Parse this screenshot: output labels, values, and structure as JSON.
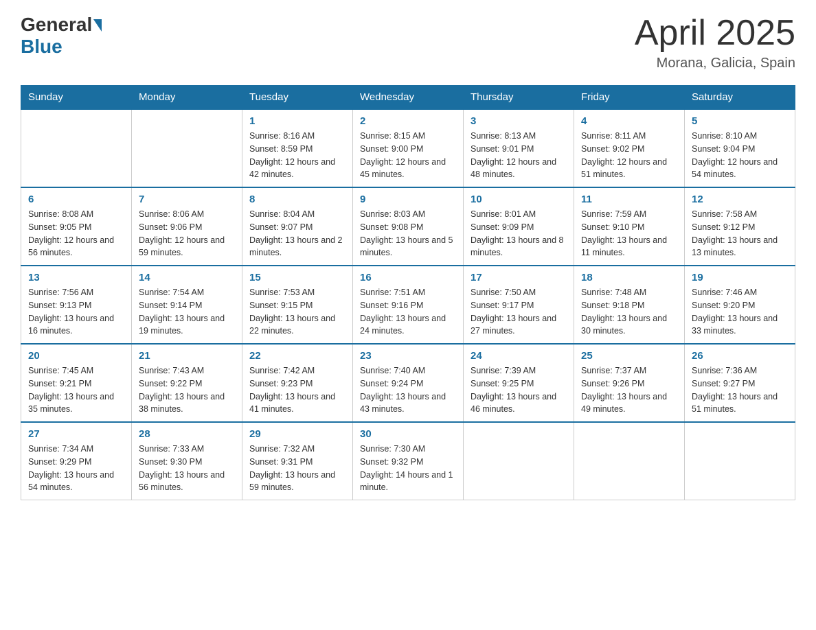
{
  "header": {
    "logo_general": "General",
    "logo_blue": "Blue",
    "month_title": "April 2025",
    "location": "Morana, Galicia, Spain"
  },
  "days_of_week": [
    "Sunday",
    "Monday",
    "Tuesday",
    "Wednesday",
    "Thursday",
    "Friday",
    "Saturday"
  ],
  "weeks": [
    [
      {
        "day": "",
        "sunrise": "",
        "sunset": "",
        "daylight": ""
      },
      {
        "day": "",
        "sunrise": "",
        "sunset": "",
        "daylight": ""
      },
      {
        "day": "1",
        "sunrise": "Sunrise: 8:16 AM",
        "sunset": "Sunset: 8:59 PM",
        "daylight": "Daylight: 12 hours and 42 minutes."
      },
      {
        "day": "2",
        "sunrise": "Sunrise: 8:15 AM",
        "sunset": "Sunset: 9:00 PM",
        "daylight": "Daylight: 12 hours and 45 minutes."
      },
      {
        "day": "3",
        "sunrise": "Sunrise: 8:13 AM",
        "sunset": "Sunset: 9:01 PM",
        "daylight": "Daylight: 12 hours and 48 minutes."
      },
      {
        "day": "4",
        "sunrise": "Sunrise: 8:11 AM",
        "sunset": "Sunset: 9:02 PM",
        "daylight": "Daylight: 12 hours and 51 minutes."
      },
      {
        "day": "5",
        "sunrise": "Sunrise: 8:10 AM",
        "sunset": "Sunset: 9:04 PM",
        "daylight": "Daylight: 12 hours and 54 minutes."
      }
    ],
    [
      {
        "day": "6",
        "sunrise": "Sunrise: 8:08 AM",
        "sunset": "Sunset: 9:05 PM",
        "daylight": "Daylight: 12 hours and 56 minutes."
      },
      {
        "day": "7",
        "sunrise": "Sunrise: 8:06 AM",
        "sunset": "Sunset: 9:06 PM",
        "daylight": "Daylight: 12 hours and 59 minutes."
      },
      {
        "day": "8",
        "sunrise": "Sunrise: 8:04 AM",
        "sunset": "Sunset: 9:07 PM",
        "daylight": "Daylight: 13 hours and 2 minutes."
      },
      {
        "day": "9",
        "sunrise": "Sunrise: 8:03 AM",
        "sunset": "Sunset: 9:08 PM",
        "daylight": "Daylight: 13 hours and 5 minutes."
      },
      {
        "day": "10",
        "sunrise": "Sunrise: 8:01 AM",
        "sunset": "Sunset: 9:09 PM",
        "daylight": "Daylight: 13 hours and 8 minutes."
      },
      {
        "day": "11",
        "sunrise": "Sunrise: 7:59 AM",
        "sunset": "Sunset: 9:10 PM",
        "daylight": "Daylight: 13 hours and 11 minutes."
      },
      {
        "day": "12",
        "sunrise": "Sunrise: 7:58 AM",
        "sunset": "Sunset: 9:12 PM",
        "daylight": "Daylight: 13 hours and 13 minutes."
      }
    ],
    [
      {
        "day": "13",
        "sunrise": "Sunrise: 7:56 AM",
        "sunset": "Sunset: 9:13 PM",
        "daylight": "Daylight: 13 hours and 16 minutes."
      },
      {
        "day": "14",
        "sunrise": "Sunrise: 7:54 AM",
        "sunset": "Sunset: 9:14 PM",
        "daylight": "Daylight: 13 hours and 19 minutes."
      },
      {
        "day": "15",
        "sunrise": "Sunrise: 7:53 AM",
        "sunset": "Sunset: 9:15 PM",
        "daylight": "Daylight: 13 hours and 22 minutes."
      },
      {
        "day": "16",
        "sunrise": "Sunrise: 7:51 AM",
        "sunset": "Sunset: 9:16 PM",
        "daylight": "Daylight: 13 hours and 24 minutes."
      },
      {
        "day": "17",
        "sunrise": "Sunrise: 7:50 AM",
        "sunset": "Sunset: 9:17 PM",
        "daylight": "Daylight: 13 hours and 27 minutes."
      },
      {
        "day": "18",
        "sunrise": "Sunrise: 7:48 AM",
        "sunset": "Sunset: 9:18 PM",
        "daylight": "Daylight: 13 hours and 30 minutes."
      },
      {
        "day": "19",
        "sunrise": "Sunrise: 7:46 AM",
        "sunset": "Sunset: 9:20 PM",
        "daylight": "Daylight: 13 hours and 33 minutes."
      }
    ],
    [
      {
        "day": "20",
        "sunrise": "Sunrise: 7:45 AM",
        "sunset": "Sunset: 9:21 PM",
        "daylight": "Daylight: 13 hours and 35 minutes."
      },
      {
        "day": "21",
        "sunrise": "Sunrise: 7:43 AM",
        "sunset": "Sunset: 9:22 PM",
        "daylight": "Daylight: 13 hours and 38 minutes."
      },
      {
        "day": "22",
        "sunrise": "Sunrise: 7:42 AM",
        "sunset": "Sunset: 9:23 PM",
        "daylight": "Daylight: 13 hours and 41 minutes."
      },
      {
        "day": "23",
        "sunrise": "Sunrise: 7:40 AM",
        "sunset": "Sunset: 9:24 PM",
        "daylight": "Daylight: 13 hours and 43 minutes."
      },
      {
        "day": "24",
        "sunrise": "Sunrise: 7:39 AM",
        "sunset": "Sunset: 9:25 PM",
        "daylight": "Daylight: 13 hours and 46 minutes."
      },
      {
        "day": "25",
        "sunrise": "Sunrise: 7:37 AM",
        "sunset": "Sunset: 9:26 PM",
        "daylight": "Daylight: 13 hours and 49 minutes."
      },
      {
        "day": "26",
        "sunrise": "Sunrise: 7:36 AM",
        "sunset": "Sunset: 9:27 PM",
        "daylight": "Daylight: 13 hours and 51 minutes."
      }
    ],
    [
      {
        "day": "27",
        "sunrise": "Sunrise: 7:34 AM",
        "sunset": "Sunset: 9:29 PM",
        "daylight": "Daylight: 13 hours and 54 minutes."
      },
      {
        "day": "28",
        "sunrise": "Sunrise: 7:33 AM",
        "sunset": "Sunset: 9:30 PM",
        "daylight": "Daylight: 13 hours and 56 minutes."
      },
      {
        "day": "29",
        "sunrise": "Sunrise: 7:32 AM",
        "sunset": "Sunset: 9:31 PM",
        "daylight": "Daylight: 13 hours and 59 minutes."
      },
      {
        "day": "30",
        "sunrise": "Sunrise: 7:30 AM",
        "sunset": "Sunset: 9:32 PM",
        "daylight": "Daylight: 14 hours and 1 minute."
      },
      {
        "day": "",
        "sunrise": "",
        "sunset": "",
        "daylight": ""
      },
      {
        "day": "",
        "sunrise": "",
        "sunset": "",
        "daylight": ""
      },
      {
        "day": "",
        "sunrise": "",
        "sunset": "",
        "daylight": ""
      }
    ]
  ]
}
